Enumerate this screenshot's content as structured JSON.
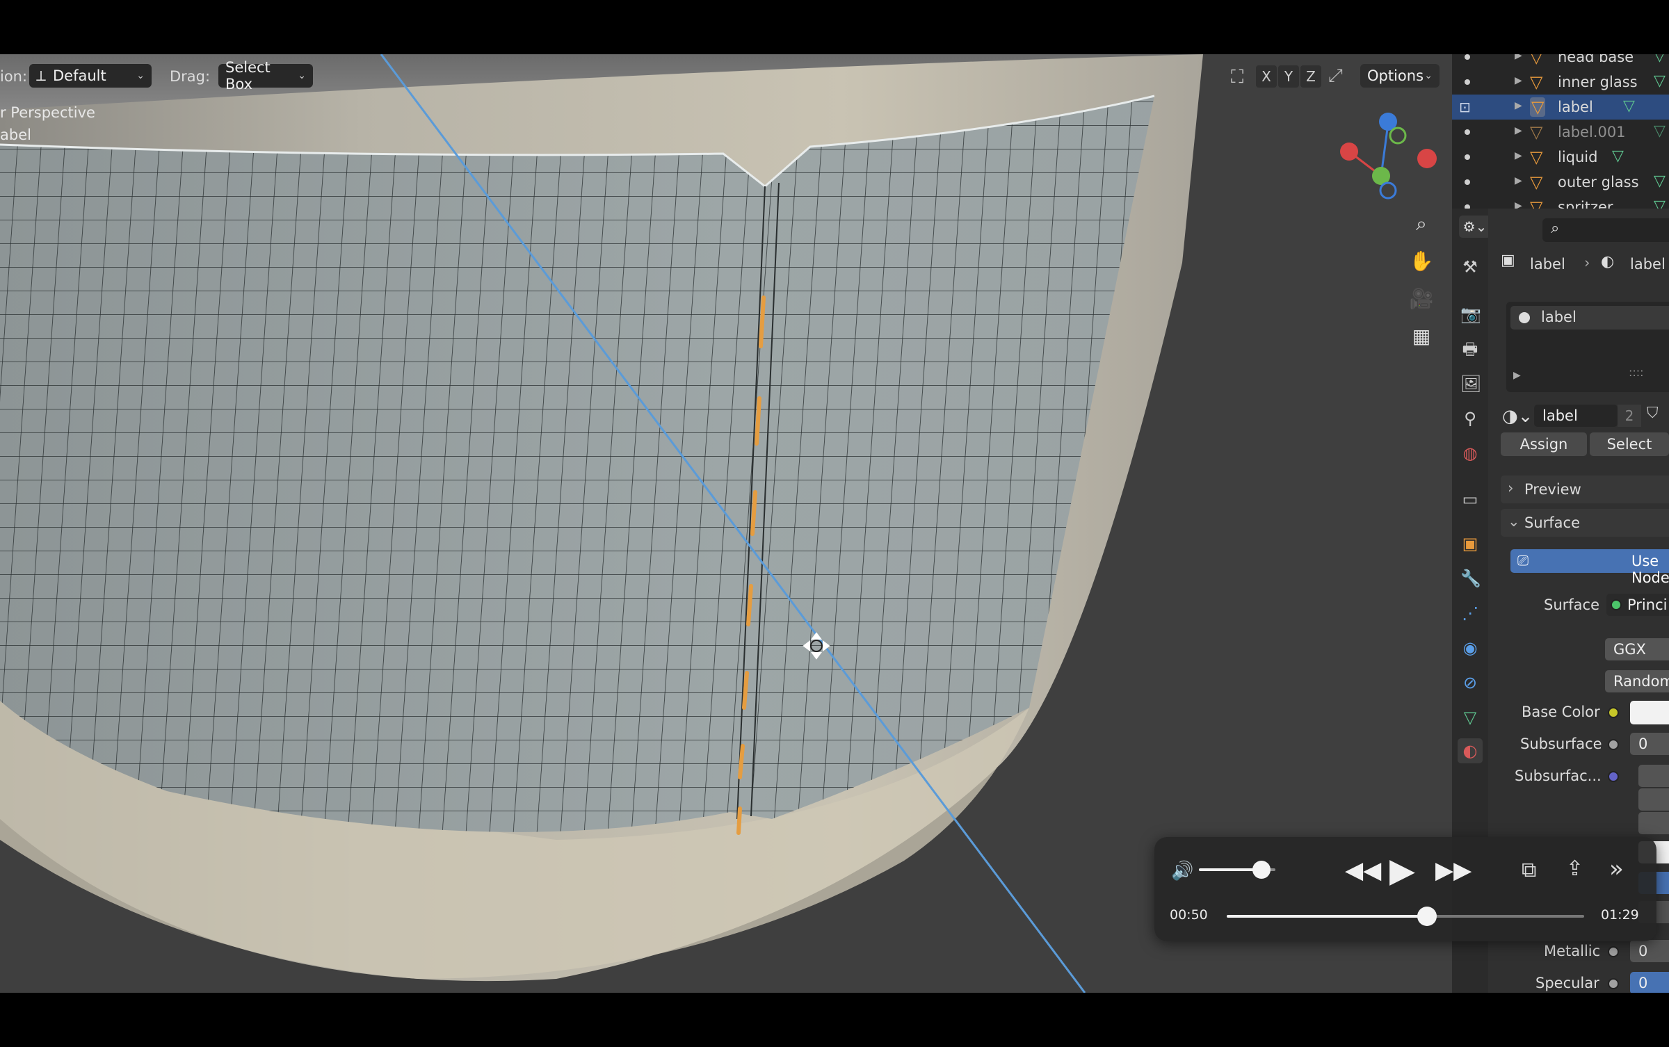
{
  "viewport_header": {
    "orientation_label": "ion:",
    "orientation_value": "Default",
    "drag_label": "Drag:",
    "drag_value": "Select Box",
    "axes": [
      "X",
      "Y",
      "Z"
    ],
    "options_label": "Options"
  },
  "viewport_overlay": {
    "line1": "r Perspective",
    "line2": "abel"
  },
  "gizmo": {
    "x": "X",
    "y": "Y",
    "z": "Z"
  },
  "outliner": {
    "items": [
      {
        "name": "head base",
        "selected": false
      },
      {
        "name": "inner glass",
        "selected": false
      },
      {
        "name": "label",
        "selected": true
      },
      {
        "name": "label.001",
        "selected": false
      },
      {
        "name": "liquid",
        "selected": false
      },
      {
        "name": "outer glass",
        "selected": false
      },
      {
        "name": "spritzer",
        "selected": false
      }
    ]
  },
  "properties": {
    "breadcrumb_object": "label",
    "breadcrumb_material": "label",
    "slot_name": "label",
    "material_name": "label",
    "material_users": "2",
    "assign_label": "Assign",
    "select_label": "Select",
    "preview_label": "Preview",
    "surface_panel_label": "Surface",
    "use_nodes_label": "Use Node",
    "surface_label": "Surface",
    "surface_value": "Princi",
    "distribution_value": "GGX",
    "subsurface_method_value": "Random",
    "rows": [
      {
        "label": "Base Color",
        "socket_color": "#c7c729"
      },
      {
        "label": "Subsurface",
        "socket_color": "#a1a1a1",
        "value": "0"
      },
      {
        "label": "Subsurfac...",
        "socket_color": "#6363c7"
      },
      {
        "label": "Metallic",
        "socket_color": "#a1a1a1",
        "value": "0"
      },
      {
        "label": "Specular",
        "socket_color": "#a1a1a1",
        "value": "0"
      }
    ]
  },
  "player": {
    "current_time": "00:50",
    "duration": "01:29",
    "progress": 0.56,
    "volume": 0.82
  }
}
